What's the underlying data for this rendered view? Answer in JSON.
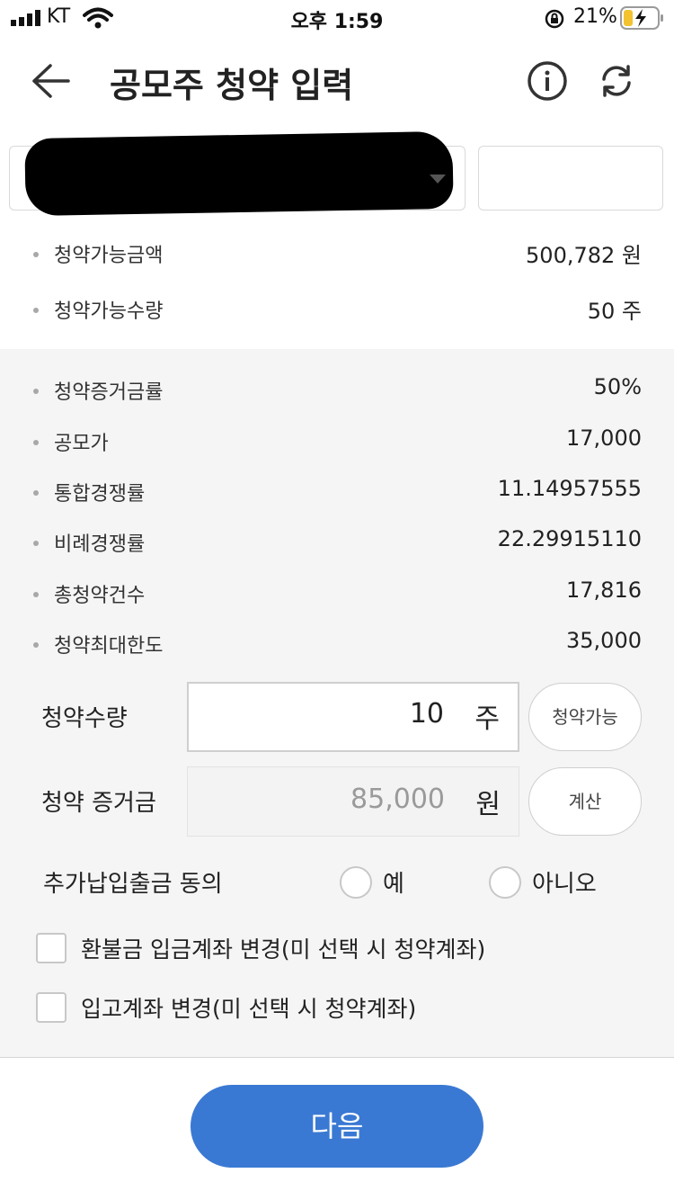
{
  "status_bar": {
    "carrier": "KT",
    "time": "오후 1:59",
    "battery": "21%"
  },
  "header": {
    "title": "공모주 청약 입력",
    "back_icon": "arrow-left-icon",
    "info_icon": "info-circle-icon",
    "refresh_icon": "refresh-icon"
  },
  "account": {
    "selected": "",
    "password": ""
  },
  "available": [
    {
      "label": "청약가능금액",
      "value": "500,782 원"
    },
    {
      "label": "청약가능수량",
      "value": "50 주"
    }
  ],
  "details": [
    {
      "label": "청약증거금률",
      "value": "50%"
    },
    {
      "label": "공모가",
      "value": "17,000"
    },
    {
      "label": "통합경쟁률",
      "value": "11.14957555"
    },
    {
      "label": "비례경쟁률",
      "value": "22.29915110"
    },
    {
      "label": "총청약건수",
      "value": "17,816"
    },
    {
      "label": "청약최대한도",
      "value": "35,000"
    }
  ],
  "form": {
    "qty_label": "청약수량",
    "qty_value": "10",
    "qty_unit": "주",
    "avail_button": "청약가능",
    "deposit_label": "청약 증거금",
    "deposit_value": "85,000",
    "deposit_unit": "원",
    "calc_button": "계산",
    "consent_label": "추가납입출금 동의",
    "yes_label": "예",
    "no_label": "아니오",
    "refund_label": "환불금 입금계좌 변경(미 선택 시 청약계좌)",
    "stock_label": "입고계좌 변경(미 선택 시 청약계좌)"
  },
  "next_button": "다음",
  "colors": {
    "primary": "#3a79d3",
    "section_bg": "#f5f5f5"
  }
}
